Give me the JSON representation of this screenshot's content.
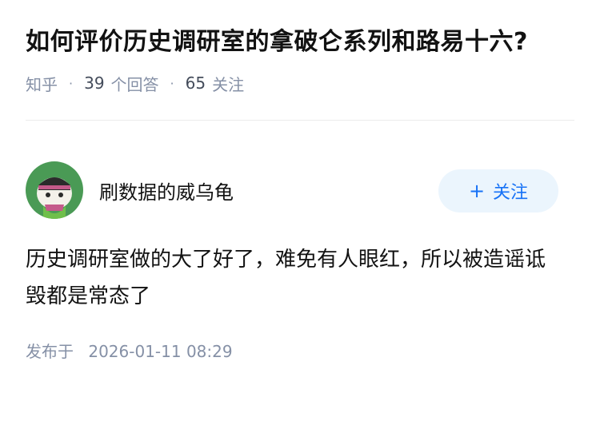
{
  "question": {
    "title": "如何评价历史调研室的拿破仑系列和路易十六?",
    "source": "知乎",
    "answer_count": "39",
    "answer_label": "个回答",
    "follower_count": "65",
    "follower_label": "关注"
  },
  "answer": {
    "author_name": "刷数据的威乌龟",
    "follow_button_label": "关注",
    "follow_icon": "plus-icon",
    "content": "历史调研室做的大了好了，难免有人眼红，所以被造谣诋毁都是常态了",
    "publish_label": "发布于",
    "publish_time": "2026-01-11 08:29"
  },
  "colors": {
    "accent": "#1772f6",
    "follow_bg": "#ebf5fd",
    "meta": "#8590a6"
  }
}
